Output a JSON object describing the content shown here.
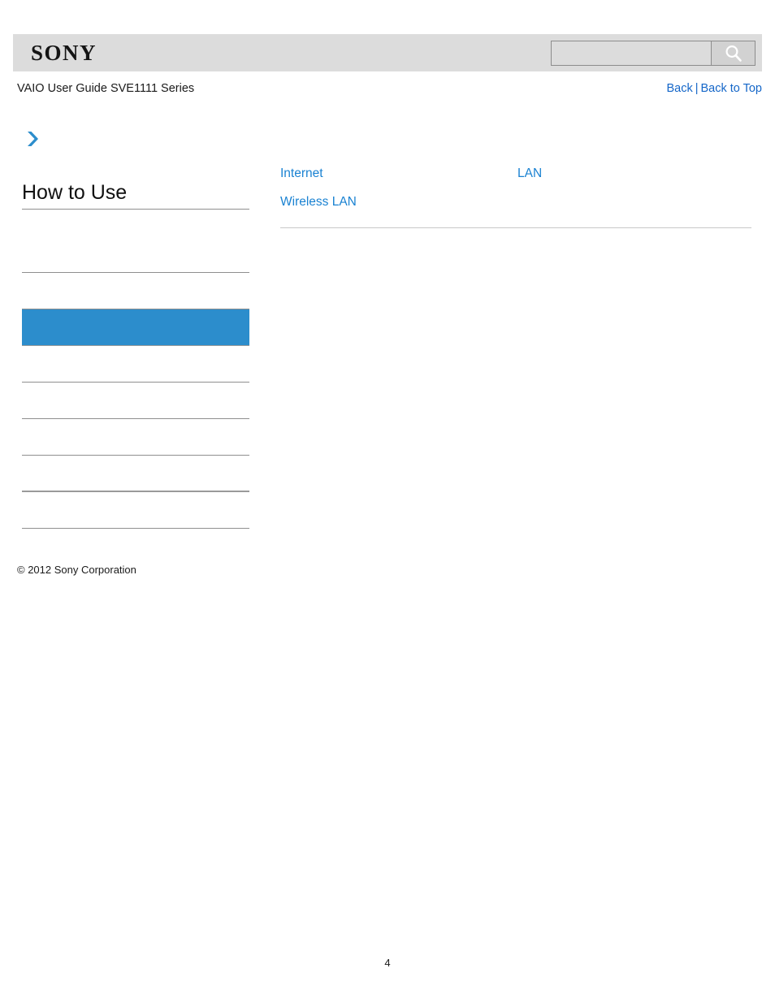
{
  "header": {
    "logo_text": "SONY",
    "search": {
      "value": "",
      "placeholder": "",
      "icon": "search-icon",
      "button_label": ""
    }
  },
  "subheader": {
    "guide_title": "VAIO User Guide SVE1111 Series",
    "back_label": "Back",
    "separator": "|",
    "back_to_top_label": "Back to Top"
  },
  "sidebar": {
    "expand_icon": "chevron-right-icon",
    "heading": "How to Use",
    "accent_color": "#2c8dcc",
    "items": [
      {
        "label": "",
        "selected": false
      },
      {
        "label": "",
        "selected": false
      },
      {
        "label": "",
        "selected": true
      },
      {
        "label": "",
        "selected": false
      },
      {
        "label": "",
        "selected": false
      },
      {
        "label": "",
        "selected": false
      },
      {
        "label": "",
        "selected": false
      },
      {
        "label": "",
        "selected": false
      },
      {
        "label": "",
        "selected": false
      }
    ]
  },
  "content": {
    "left_column": [
      {
        "label": "Internet"
      },
      {
        "label": "Wireless LAN"
      }
    ],
    "right_column": [
      {
        "label": "LAN"
      }
    ]
  },
  "footer": {
    "copyright": "© 2012 Sony Corporation",
    "page_number": "4"
  }
}
